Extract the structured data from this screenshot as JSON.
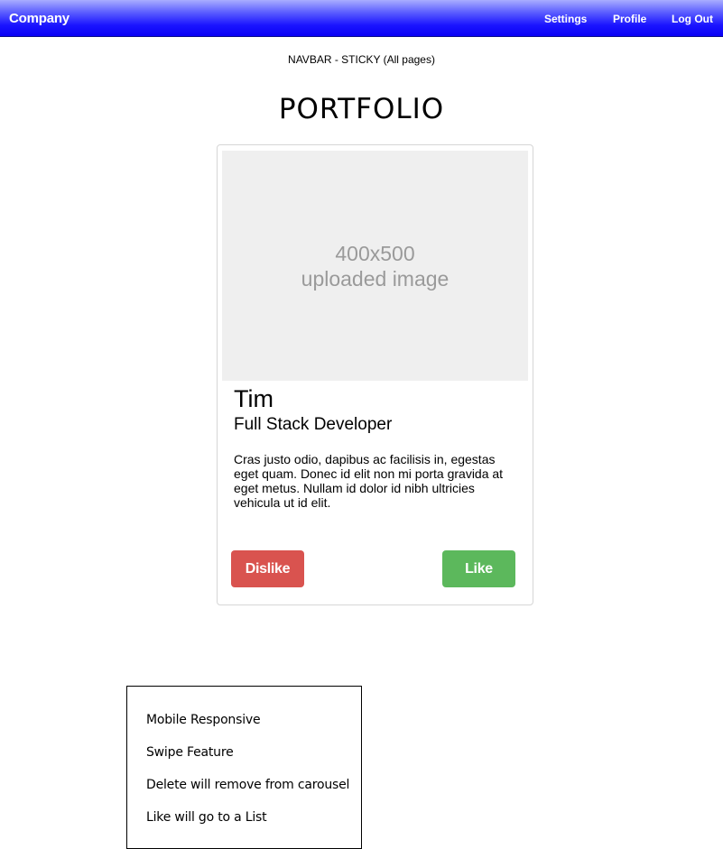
{
  "navbar": {
    "brand": "Company",
    "links": {
      "settings": "Settings",
      "profile": "Profile",
      "logout": "Log Out"
    },
    "gradient_color": "#0a00f5"
  },
  "annotation_top": "NAVBAR - STICKY (All pages)",
  "page_title": "PORTFOLIO",
  "card": {
    "image_placeholder_line1": "400x500",
    "image_placeholder_line2": "uploaded image",
    "name": "Tim",
    "role": "Full Stack Developer",
    "description": "Cras justo odio, dapibus ac facilisis in, egestas eget quam. Donec id elit non mi porta gravida at eget metus. Nullam id dolor id nibh ultricies vehicula ut id elit.",
    "dislike_label": "Dislike",
    "like_label": "Like",
    "dislike_color": "#d9534f",
    "like_color": "#5cb85c"
  },
  "notes": [
    "Mobile Responsive",
    "Swipe Feature",
    "Delete will remove from carousel",
    "Like will go to a List"
  ]
}
